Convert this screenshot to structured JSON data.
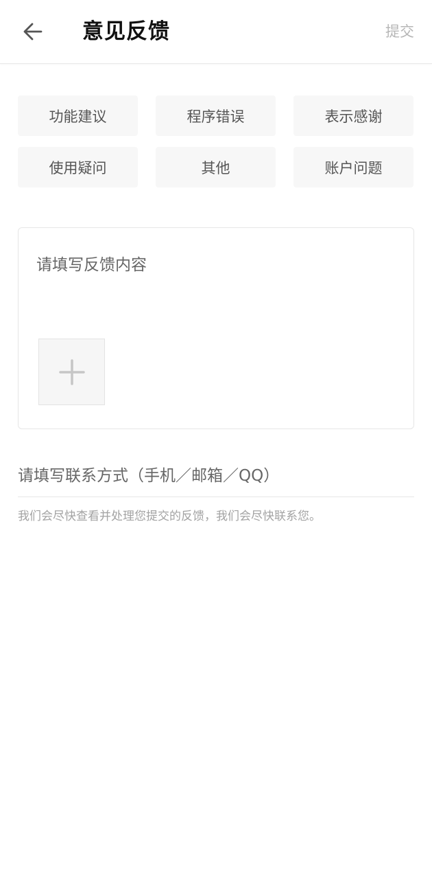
{
  "header": {
    "back_icon": "arrow-left-icon",
    "title": "意见反馈",
    "submit_label": "提交"
  },
  "categories": [
    {
      "label": "功能建议"
    },
    {
      "label": "程序错误"
    },
    {
      "label": "表示感谢"
    },
    {
      "label": "使用疑问"
    },
    {
      "label": "其他"
    },
    {
      "label": "账户问题"
    }
  ],
  "feedback": {
    "placeholder": "请填写反馈内容",
    "value": "",
    "add_image_icon": "plus-icon"
  },
  "contact": {
    "placeholder": "请填写联系方式（手机／邮箱／QQ）",
    "value": ""
  },
  "hint": "我们会尽快查看并处理您提交的反馈，我们会尽快联系您。",
  "colors": {
    "title": "#111111",
    "submit_disabled": "#b6b6b6",
    "category_bg": "#f7f7f7",
    "hint": "#a3a3a3",
    "border": "#e6e6e6"
  }
}
